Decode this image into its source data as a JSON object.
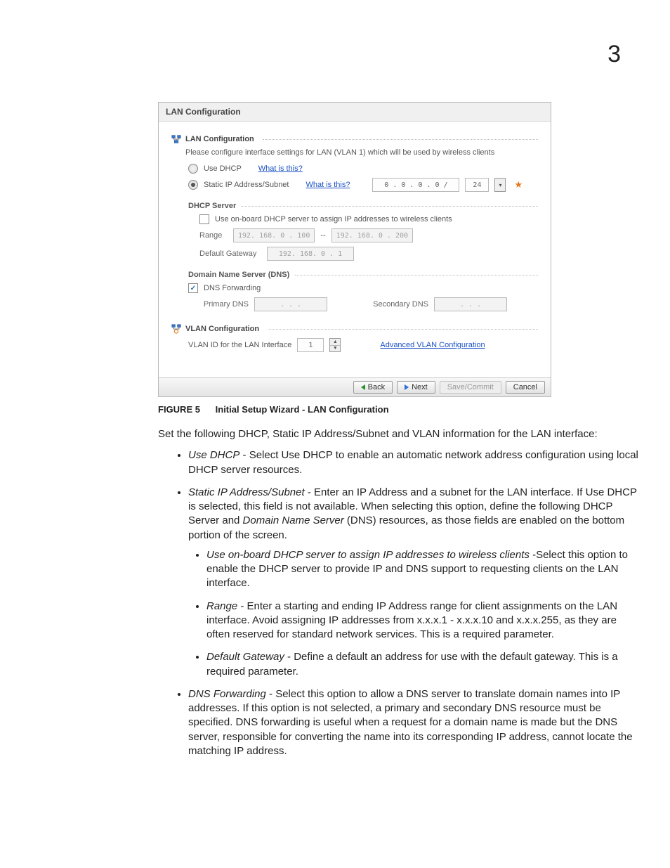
{
  "page_number": "3",
  "figure": {
    "label": "FIGURE 5",
    "caption": "Initial Setup Wizard - LAN Configuration"
  },
  "wizard": {
    "window_title": "LAN Configuration",
    "lan_section_title": "LAN Configuration",
    "lan_desc": "Please configure interface settings for LAN (VLAN 1) which will be used by wireless clients",
    "use_dhcp_label": "Use DHCP",
    "what_is_this": "What is this?",
    "static_ip_label": "Static IP Address/Subnet",
    "static_ip_value": "0 . 0 . 0 . 0 /",
    "static_subnet": "24",
    "dhcp_server_title": "DHCP Server",
    "onboard_label": "Use on-board DHCP server to assign IP addresses to wireless clients",
    "range_label": "Range",
    "range_start": "192. 168. 0 . 100",
    "range_dash": "--",
    "range_end": "192. 168. 0 . 200",
    "gateway_label": "Default Gateway",
    "gateway_value": "192. 168. 0 . 1",
    "dns_title": "Domain Name Server (DNS)",
    "dns_fwd_label": "DNS Forwarding",
    "primary_dns_label": "Primary DNS",
    "primary_dns_value": ".   .   .",
    "secondary_dns_label": "Secondary DNS",
    "secondary_dns_value": ".   .   .",
    "vlan_section_title": "VLAN Configuration",
    "vlan_id_label": "VLAN ID for the LAN Interface",
    "vlan_id_value": "1",
    "adv_vlan_link": "Advanced VLAN Configuration",
    "btn_back": "Back",
    "btn_next": "Next",
    "btn_save": "Save/Commit",
    "btn_cancel": "Cancel"
  },
  "body": {
    "intro": "Set the following DHCP, Static IP Address/Subnet and VLAN information for the LAN interface:",
    "b1_term": "Use DHCP",
    "b1_rest": " - Select Use DHCP to enable an automatic network address configuration using local DHCP server resources.",
    "b2_term": "Static IP Address/Subnet",
    "b2_rest": " - Enter an IP Address and a subnet for the LAN interface. If Use DHCP is selected, this field is not available. When selecting this option, define the following DHCP Server and ",
    "b2_term2": "Domain Name Server",
    "b2_rest2": " (DNS) resources, as those fields are enabled on the bottom portion of the screen.",
    "b2a_term": "Use on-board DHCP server to assign IP addresses to wireless clients",
    "b2a_rest": " -Select this option to enable the DHCP server to provide IP and DNS support to requesting clients on the LAN interface.",
    "b2b_term": "Range",
    "b2b_rest": " - Enter a starting and ending IP Address range for client assignments on the LAN interface. Avoid assigning IP addresses from x.x.x.1 - x.x.x.10 and x.x.x.255, as they are often reserved for standard network services. This is a required parameter.",
    "b2c_term": "Default Gateway",
    "b2c_rest": " - Define a default an address for use with the default gateway. This is a required parameter.",
    "b3_term": "DNS Forwarding",
    "b3_rest": " - Select this option to allow a DNS server to translate domain names into IP addresses. If this option is not selected, a primary and secondary DNS resource must be specified. DNS forwarding is useful when a request for a domain name is made but the DNS server, responsible for converting the name into its corresponding IP address, cannot locate the matching IP address."
  }
}
